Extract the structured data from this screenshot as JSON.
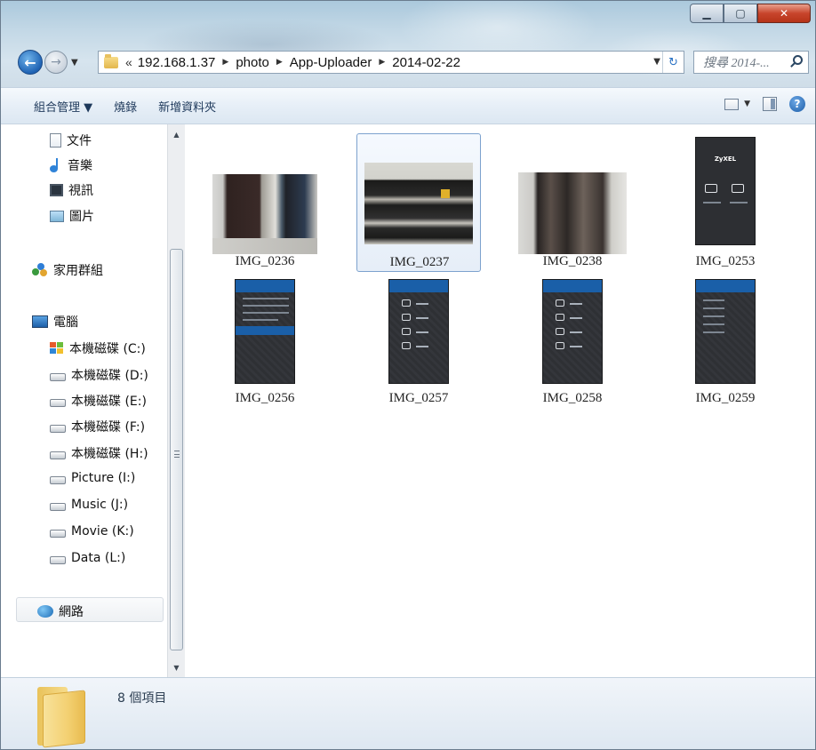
{
  "window": {
    "caption_buttons": [
      "minimize-icon",
      "maximize-icon",
      "close-icon"
    ]
  },
  "address": {
    "overflow": "«",
    "crumbs": [
      "192.168.1.37",
      "photo",
      "App-Uploader",
      "2014-02-22"
    ],
    "search_placeholder": "搜尋 2014-..."
  },
  "toolbar": {
    "organize": "組合管理 ▼",
    "burn": "燒錄",
    "new_folder": "新增資料夾"
  },
  "nav": {
    "libraries": [
      {
        "label": "文件",
        "icon": "document-icon"
      },
      {
        "label": "音樂",
        "icon": "music-icon"
      },
      {
        "label": "視訊",
        "icon": "video-icon"
      },
      {
        "label": "圖片",
        "icon": "pictures-icon"
      }
    ],
    "homegroup": {
      "label": "家用群組",
      "icon": "homegroup-icon"
    },
    "computer": {
      "label": "電腦",
      "icon": "computer-icon"
    },
    "drives": [
      {
        "label": "本機磁碟 (C:)",
        "icon": "windows-drive-icon"
      },
      {
        "label": "本機磁碟 (D:)",
        "icon": "drive-icon"
      },
      {
        "label": "本機磁碟 (E:)",
        "icon": "drive-icon"
      },
      {
        "label": "本機磁碟 (F:)",
        "icon": "drive-icon"
      },
      {
        "label": "本機磁碟 (H:)",
        "icon": "drive-icon"
      },
      {
        "label": "Picture (I:)",
        "icon": "drive-icon"
      },
      {
        "label": "Music (J:)",
        "icon": "drive-icon"
      },
      {
        "label": "Movie (K:)",
        "icon": "drive-icon"
      },
      {
        "label": "Data (L:)",
        "icon": "drive-icon"
      }
    ],
    "network": {
      "label": "網路",
      "icon": "network-icon"
    }
  },
  "files": [
    {
      "name": "IMG_0236",
      "kind": "photo"
    },
    {
      "name": "IMG_0237",
      "kind": "photo",
      "selected": true
    },
    {
      "name": "IMG_0238",
      "kind": "photo"
    },
    {
      "name": "IMG_0253",
      "kind": "app-screenshot",
      "screen_text": "ZyXEL"
    },
    {
      "name": "IMG_0256",
      "kind": "app-screenshot"
    },
    {
      "name": "IMG_0257",
      "kind": "app-screenshot"
    },
    {
      "name": "IMG_0258",
      "kind": "app-screenshot"
    },
    {
      "name": "IMG_0259",
      "kind": "app-screenshot"
    }
  ],
  "status": {
    "item_count": "8 個項目"
  },
  "colors": {
    "accent": "#1a5fa8",
    "selection_border": "#7da2ce",
    "close_button": "#c8452c"
  }
}
